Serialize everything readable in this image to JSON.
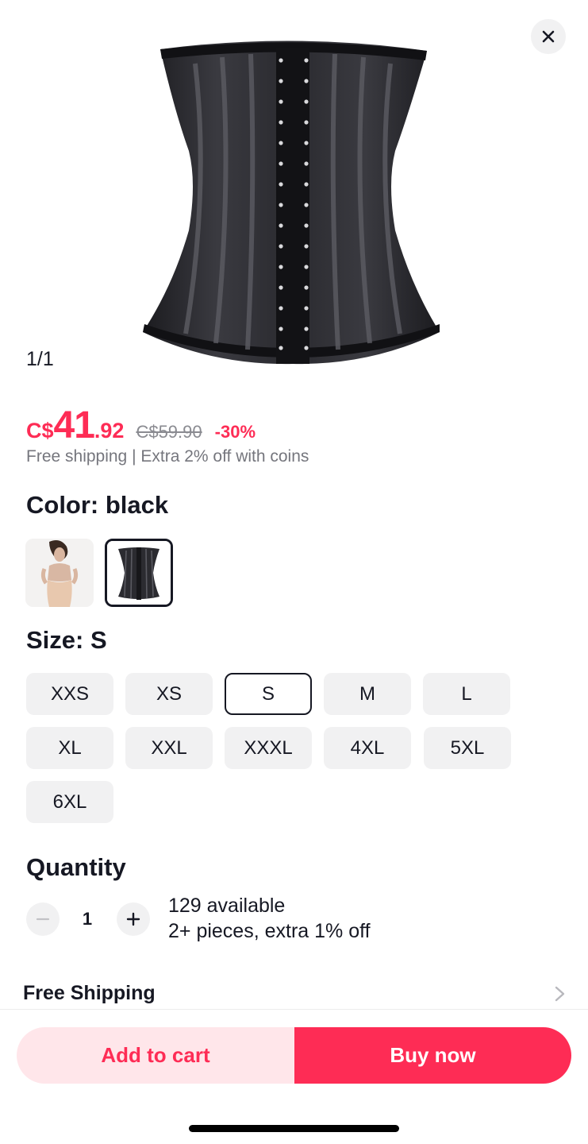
{
  "gallery": {
    "counter": "1/1"
  },
  "price": {
    "currency": "C$",
    "integer": "41",
    "decimal": ".92",
    "original": "C$59.90",
    "discount": "-30%",
    "note": "Free shipping | Extra 2% off with coins",
    "accent_color": "#fe2c55"
  },
  "color": {
    "title": "Color: black",
    "options": [
      {
        "icon": "model-photo-thumbnail",
        "selected": false
      },
      {
        "icon": "black-corset-thumbnail",
        "selected": true
      }
    ]
  },
  "size": {
    "title": "Size: S",
    "options": [
      "XXS",
      "XS",
      "S",
      "M",
      "L",
      "XL",
      "XXL",
      "XXXL",
      "4XL",
      "5XL",
      "6XL"
    ],
    "selected": "S"
  },
  "quantity": {
    "title": "Quantity",
    "value": "1",
    "available": "129 available",
    "promo": "2+ pieces, extra 1% off"
  },
  "shipping": {
    "label": "Free Shipping"
  },
  "actions": {
    "add_to_cart": "Add to cart",
    "buy_now": "Buy now"
  }
}
